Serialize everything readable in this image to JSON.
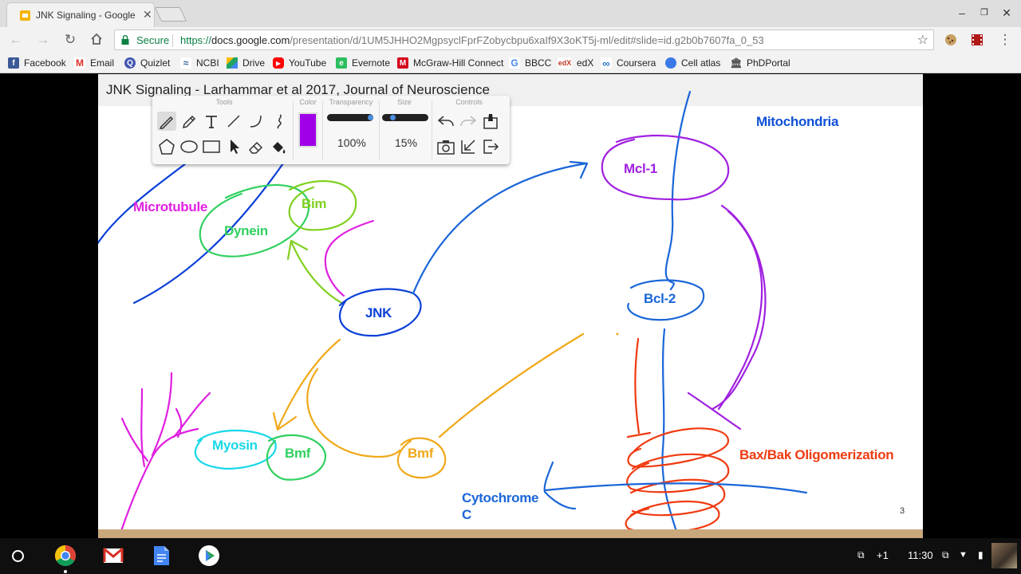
{
  "browser": {
    "tab_title": "JNK Signaling - Google",
    "url_secure_label": "Secure",
    "url_scheme": "https://",
    "url_host": "docs.google.com",
    "url_path": "/presentation/d/1UM5JHHO2MgpsyclFprFZobycbpu6xaIf9X3oKT5j-ml/edit#slide=id.g2b0b7607fa_0_53"
  },
  "bookmarks": [
    {
      "label": "Facebook",
      "icon": "facebook-icon",
      "color": "#3b5998"
    },
    {
      "label": "Email",
      "icon": "gmail-icon",
      "color": "#d93025"
    },
    {
      "label": "Quizlet",
      "icon": "quizlet-icon",
      "color": "#4257b2"
    },
    {
      "label": "NCBI",
      "icon": "ncbi-icon",
      "color": "#336699"
    },
    {
      "label": "Drive",
      "icon": "drive-icon",
      "color": "#1fa463"
    },
    {
      "label": "YouTube",
      "icon": "youtube-icon",
      "color": "#ff0000"
    },
    {
      "label": "Evernote",
      "icon": "evernote-icon",
      "color": "#2dbe60"
    },
    {
      "label": "McGraw-Hill Connect",
      "icon": "mcgraw-hill-icon",
      "color": "#d6001c"
    },
    {
      "label": "BBCC",
      "icon": "google-icon",
      "color": "#4285f4"
    },
    {
      "label": "edX",
      "icon": "edx-icon",
      "color": "#c0392b"
    },
    {
      "label": "Coursera",
      "icon": "coursera-icon",
      "color": "#2a73cc"
    },
    {
      "label": "Cell atlas",
      "icon": "cell-atlas-icon",
      "color": "#3b78e7"
    },
    {
      "label": "PhDPortal",
      "icon": "phdportal-icon",
      "color": "#555555"
    }
  ],
  "slide": {
    "title": "JNK Signaling - Larhammar et al 2017, Journal of Neuroscience",
    "slide_number": "3",
    "labels": {
      "microtubule": "Microtubule",
      "dynein": "Dynein",
      "bim": "Bim",
      "jnk": "JNK",
      "myosin": "Myosin",
      "bmf_left": "Bmf",
      "bmf_right": "Bmf",
      "mcl1": "Mcl-1",
      "bcl2": "Bcl-2",
      "mitochondria": "Mitochondria",
      "bax_bak": "Bax/Bak Oligomerization",
      "cyto_line1": "Cytochrome",
      "cyto_line2": "C"
    },
    "colors": {
      "magenta": "#e020e0",
      "blue": "#0a3fd8",
      "midblue": "#1a66d8",
      "green": "#30d060",
      "lime": "#80d020",
      "cyan": "#18d8e8",
      "orange": "#f0a818",
      "purple": "#a020e0",
      "red": "#f03a10",
      "label_blue": "#1050d8"
    }
  },
  "palette": {
    "tools_label": "Tools",
    "color_label": "Color",
    "transparency_label": "Transparency",
    "size_label": "Size",
    "controls_label": "Controls",
    "transparency_value": "100%",
    "size_value": "15%",
    "transparency_level": 1.0,
    "size_level": 0.15,
    "pen_color": "#a000e8"
  },
  "shelf": {
    "time": "11:30",
    "notification_count": "+1",
    "apps": [
      "chrome-icon",
      "gmail-icon",
      "docs-icon",
      "play-store-icon"
    ]
  }
}
